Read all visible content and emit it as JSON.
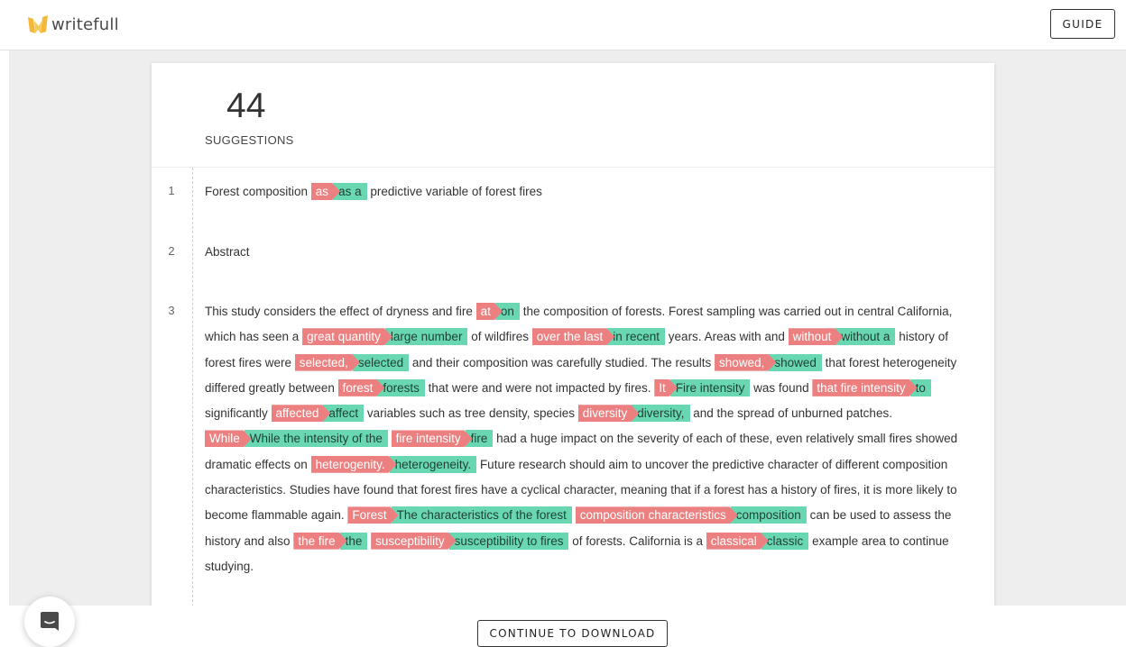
{
  "header": {
    "brand": "writefull",
    "guide_label": "GUIDE"
  },
  "summary": {
    "count": "44",
    "label": "SUGGESTIONS"
  },
  "colors": {
    "deletion": "#ec8080",
    "insertion": "#69d8b2",
    "logo_yellow": "#f4b83a"
  },
  "paragraphs": [
    {
      "number": "1",
      "segments": [
        {
          "t": "Forest composition "
        },
        {
          "del": "as",
          "ins": "as a"
        },
        {
          "t": " predictive variable of forest fires"
        }
      ]
    },
    {
      "number": "2",
      "segments": [
        {
          "t": "Abstract"
        }
      ]
    },
    {
      "number": "3",
      "segments": [
        {
          "t": "This study considers the effect of dryness and fire "
        },
        {
          "del": "at",
          "ins": "on"
        },
        {
          "t": " the composition of forests. Forest sampling was carried out in central California, which has seen a "
        },
        {
          "del": "great quantity",
          "ins": "large number"
        },
        {
          "t": " of wildfires "
        },
        {
          "del": "over the last",
          "ins": "in recent"
        },
        {
          "t": " years. Areas with and "
        },
        {
          "del": "without",
          "ins": "without a"
        },
        {
          "t": " history of forest fires were "
        },
        {
          "del": "selected,",
          "ins": "selected"
        },
        {
          "t": " and their composition was carefully studied. The results "
        },
        {
          "del": "showed,",
          "ins": "showed"
        },
        {
          "t": " that forest heterogeneity differed greatly between "
        },
        {
          "del": "forest",
          "ins": "forests"
        },
        {
          "t": " that were and were not impacted by fires. "
        },
        {
          "del": "It",
          "ins": "Fire intensity"
        },
        {
          "t": " was found "
        },
        {
          "del": "that fire intensity",
          "ins": "to"
        },
        {
          "t": " significantly "
        },
        {
          "del": "affected",
          "ins": "affect"
        },
        {
          "t": " variables such as tree density, species "
        },
        {
          "del": "diversity",
          "ins": "diversity,"
        },
        {
          "t": " and the spread of unburned patches. "
        },
        {
          "del": "While",
          "ins": "While the intensity of the"
        },
        {
          "t": " "
        },
        {
          "del": "fire intensity",
          "ins": "fire"
        },
        {
          "t": " had a huge impact on the severity of each of these, even relatively small fires showed dramatic effects on "
        },
        {
          "del": "heterogenity.",
          "ins": "heterogeneity."
        },
        {
          "t": " Future research should aim to uncover the predictive character of different composition characteristics. Studies have found that forest fires have a cyclical character, meaning that if a forest has a history of fires, it is more likely to become flammable again. "
        },
        {
          "del": "Forest",
          "ins": "The characteristics of the forest"
        },
        {
          "t": " "
        },
        {
          "del": "composition characteristics",
          "ins": "composition"
        },
        {
          "t": " can be used to assess the history and also "
        },
        {
          "del": "the fire",
          "ins": "the"
        },
        {
          "t": " "
        },
        {
          "del": "susceptibility",
          "ins": "susceptibility to fires"
        },
        {
          "t": " of forests. California is a "
        },
        {
          "del": "classical",
          "ins": "classic"
        },
        {
          "t": " example area to continue studying."
        }
      ]
    }
  ],
  "footer": {
    "download_label": "CONTINUE TO DOWNLOAD"
  }
}
